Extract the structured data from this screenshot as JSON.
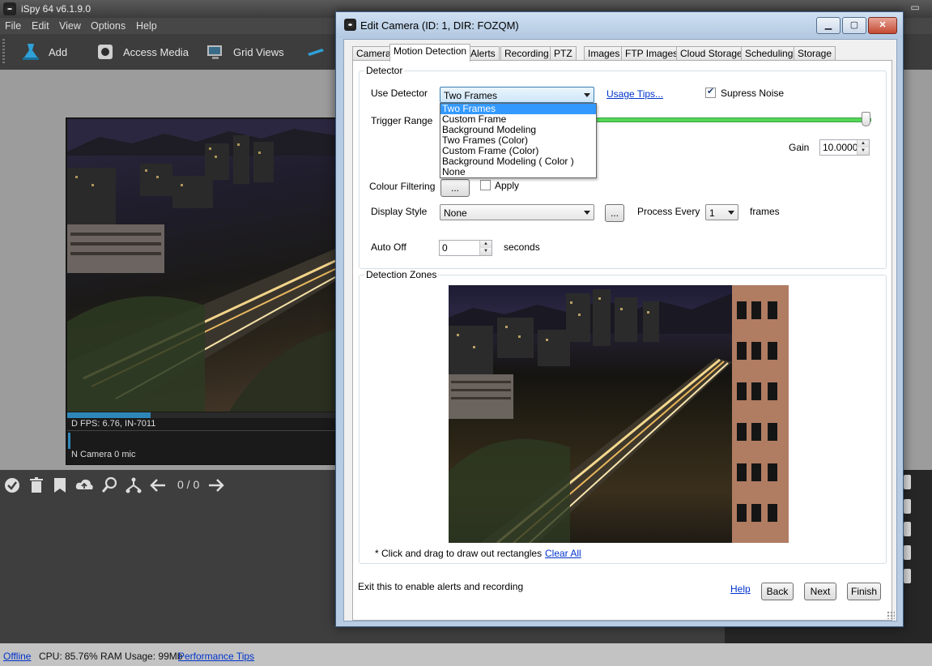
{
  "main_window": {
    "title": "iSpy 64 v6.1.9.0",
    "menu": [
      "File",
      "Edit",
      "View",
      "Options",
      "Help"
    ],
    "toolbar": [
      {
        "label": "Add",
        "icon": "add-camera-icon"
      },
      {
        "label": "Access Media",
        "icon": "media-icon"
      },
      {
        "label": "Grid Views",
        "icon": "grid-views-icon"
      }
    ],
    "camera": {
      "status_line": "D  FPS: 6.76, IN-7011",
      "camera_line": "N  Camera 0 mic",
      "progress": 0.31
    },
    "bottom_toolbar": {
      "icons": [
        "check-icon",
        "trash-icon",
        "bookmark-icon",
        "cloud-upload-icon",
        "search-icon",
        "merge-icon",
        "arrow-left-icon",
        "arrow-right-icon"
      ],
      "counter": "0 / 0"
    },
    "statusbar": {
      "offline": "Offline",
      "usage": "CPU: 85.76% RAM Usage: 99Mb",
      "tips": "Performance Tips"
    }
  },
  "dialog": {
    "title": "Edit Camera (ID: 1, DIR: FOZQM)",
    "tabs": [
      "Camera",
      "Motion Detection",
      "Alerts",
      "Recording",
      "PTZ",
      "Images",
      "FTP Images",
      "Cloud Storage",
      "Scheduling",
      "Storage"
    ],
    "active_tab": "Motion Detection",
    "detector": {
      "group_label": "Detector",
      "use_detector_label": "Use Detector",
      "use_detector_value": "Two Frames",
      "detector_options": [
        "Two Frames",
        "Custom Frame",
        "Background Modeling",
        "Two Frames (Color)",
        "Custom Frame (Color)",
        "Background Modeling ( Color )",
        "None"
      ],
      "usage_tips": "Usage Tips...",
      "supress_noise_label": "Supress Noise",
      "supress_noise_checked": true,
      "trigger_range_label": "Trigger Range",
      "gain_label": "Gain",
      "gain_value": "10.00000",
      "colour_filtering_label": "Colour Filtering",
      "colour_button": "...",
      "apply_label": "Apply",
      "apply_checked": false,
      "display_style_label": "Display Style",
      "display_style_value": "None",
      "display_button": "...",
      "process_every_label": "Process Every",
      "process_every_value": "1",
      "frames_label": "frames",
      "auto_off_label": "Auto Off",
      "auto_off_value": "0",
      "seconds_label": "seconds"
    },
    "zones": {
      "group_label": "Detection Zones",
      "hint": "* Click and drag to draw out rectangles",
      "clear_all": "Clear All"
    },
    "footer": {
      "message": "Exit this to enable alerts and recording",
      "help": "Help",
      "back": "Back",
      "next": "Next",
      "finish": "Finish"
    }
  }
}
